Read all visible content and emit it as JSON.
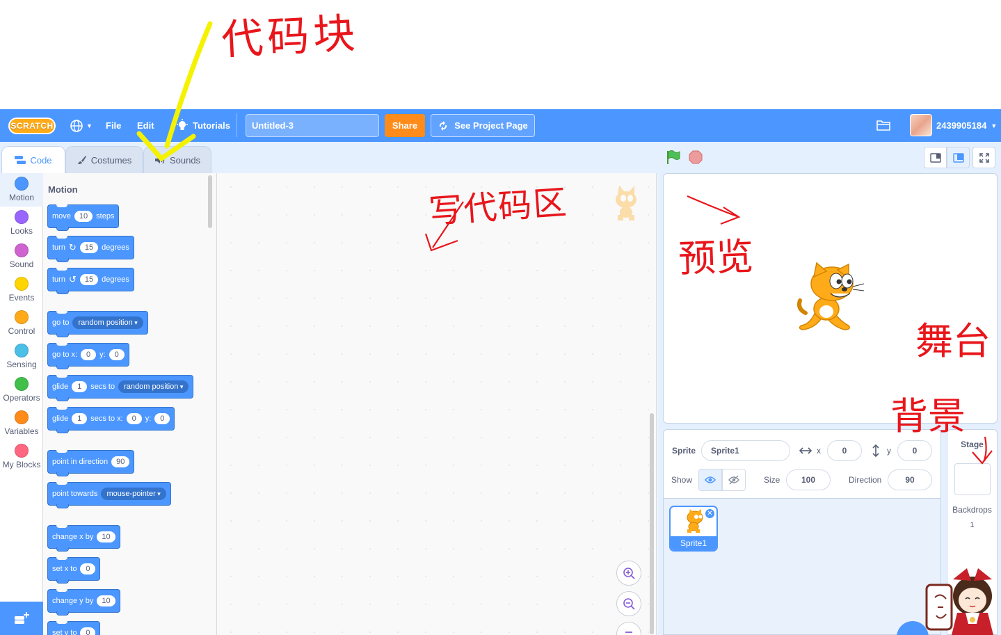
{
  "menubar": {
    "logo_text": "SCRATCH",
    "file": "File",
    "edit": "Edit",
    "tutorials": "Tutorials",
    "project_title": "Untitled-3",
    "share": "Share",
    "see_project_page": "See Project Page",
    "username": "2439905184"
  },
  "tabs": {
    "code": "Code",
    "costumes": "Costumes",
    "sounds": "Sounds"
  },
  "categories": [
    {
      "label": "Motion",
      "color": "#4c97ff"
    },
    {
      "label": "Looks",
      "color": "#9966ff"
    },
    {
      "label": "Sound",
      "color": "#cf63cf"
    },
    {
      "label": "Events",
      "color": "#ffd500"
    },
    {
      "label": "Control",
      "color": "#ffab19"
    },
    {
      "label": "Sensing",
      "color": "#4cbfe6"
    },
    {
      "label": "Operators",
      "color": "#40bf4a"
    },
    {
      "label": "Variables",
      "color": "#ff8c1a"
    },
    {
      "label": "My Blocks",
      "color": "#ff6680"
    }
  ],
  "palette": {
    "title": "Motion",
    "move": {
      "a": "move",
      "v": "10",
      "b": "steps"
    },
    "turn_right": {
      "a": "turn",
      "v": "15",
      "b": "degrees"
    },
    "turn_left": {
      "a": "turn",
      "v": "15",
      "b": "degrees"
    },
    "go_to": {
      "a": "go to",
      "dd": "random position"
    },
    "go_to_xy": {
      "a": "go to x:",
      "x": "0",
      "b": "y:",
      "y": "0"
    },
    "glide_to": {
      "a": "glide",
      "v": "1",
      "b": "secs to",
      "dd": "random position"
    },
    "glide_xy": {
      "a": "glide",
      "v": "1",
      "b": "secs to x:",
      "x": "0",
      "c": "y:",
      "y": "0"
    },
    "point_dir": {
      "a": "point in direction",
      "v": "90"
    },
    "point_towards": {
      "a": "point towards",
      "dd": "mouse-pointer"
    },
    "change_x": {
      "a": "change x by",
      "v": "10"
    },
    "set_x": {
      "a": "set x to",
      "v": "0"
    },
    "change_y": {
      "a": "change y by",
      "v": "10"
    },
    "set_y": {
      "a": "set y to",
      "v": "0"
    }
  },
  "sprite_info": {
    "sprite_label": "Sprite",
    "sprite_name": "Sprite1",
    "x_label": "x",
    "x_value": "0",
    "y_label": "y",
    "y_value": "0",
    "show_label": "Show",
    "size_label": "Size",
    "size_value": "100",
    "direction_label": "Direction",
    "direction_value": "90"
  },
  "sprites": [
    {
      "name": "Sprite1"
    }
  ],
  "stage_panel": {
    "title": "Stage",
    "backdrops_label": "Backdrops",
    "backdrops_count": "1"
  },
  "annotations": {
    "code_blocks": "代码块",
    "code_area": "写代码区",
    "preview": "预览",
    "stage": "舞台",
    "backdrop": "背景"
  },
  "colors": {
    "brand_blue": "#4c97ff",
    "share_orange": "#ff8c1a",
    "annotation_red": "#e8161b",
    "annotation_yellow": "#f4f200"
  }
}
